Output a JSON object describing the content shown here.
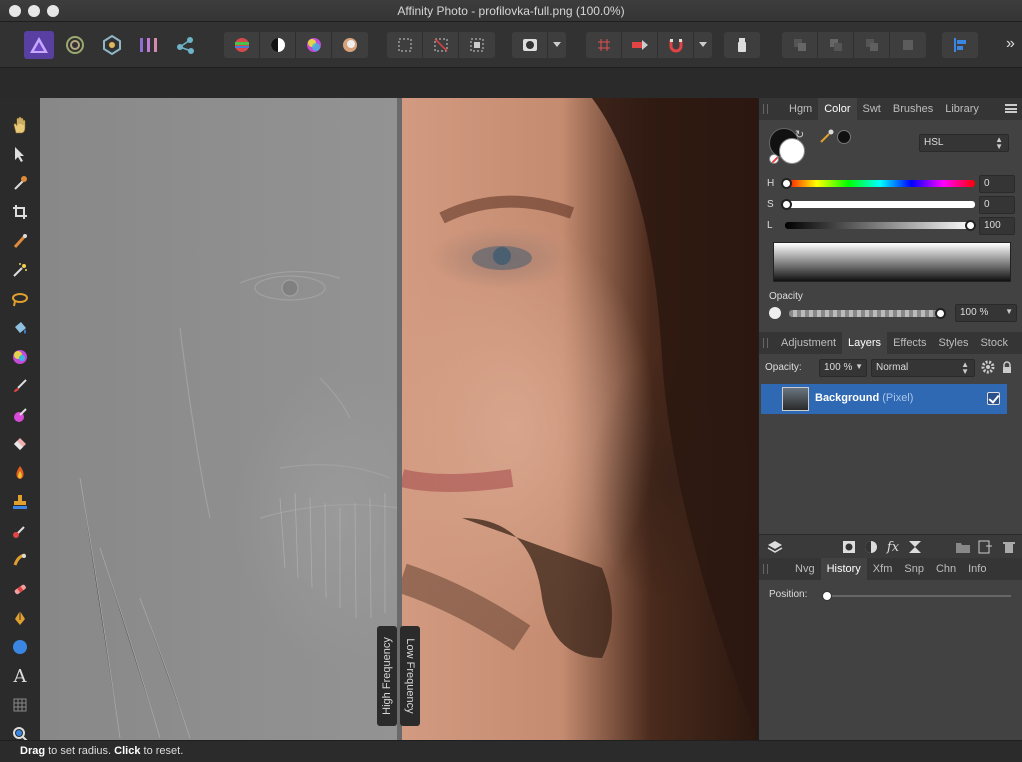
{
  "window": {
    "title": "Affinity Photo - profilovka-full.png (100.0%)"
  },
  "toolbar": {
    "personas": [
      "photo-persona-icon",
      "liquify-persona-icon",
      "develop-persona-icon",
      "tone-mapping-persona-icon",
      "export-persona-icon"
    ],
    "adjustments": [
      "auto-levels-icon",
      "auto-contrast-icon",
      "auto-colors-icon",
      "auto-white-balance-icon"
    ],
    "selection": [
      "marquee-icon",
      "deselect-icon",
      "invert-selection-icon"
    ],
    "more_label": "»"
  },
  "tools": [
    "hand-icon",
    "move-icon",
    "color-picker-icon",
    "crop-icon",
    "selection-brush-icon",
    "flood-select-icon",
    "freehand-select-icon",
    "flood-fill-icon",
    "gradient-icon",
    "paint-brush-icon",
    "color-replacement-icon",
    "erase-brush-icon",
    "dodge-icon",
    "clone-icon",
    "retouch-icon",
    "healing-icon",
    "patch-icon",
    "pen-icon",
    "shape-icon",
    "text-icon",
    "mesh-warp-icon",
    "zoom-icon"
  ],
  "canvas": {
    "left_label": "High Frequency",
    "right_label": "Low Frequency"
  },
  "status": {
    "drag": "Drag",
    "drag_text": " to set radius. ",
    "click": "Click",
    "click_text": " to reset."
  },
  "color_panel": {
    "tabs": [
      "Hgm",
      "Color",
      "Swt",
      "Brushes",
      "Library"
    ],
    "active_tab": "Color",
    "model": "HSL",
    "h_label": "H",
    "h_value": "0",
    "s_label": "S",
    "s_value": "0",
    "l_label": "L",
    "l_value": "100",
    "opacity_label": "Opacity",
    "opacity_value": "100 %"
  },
  "layers_panel": {
    "tabs": [
      "Adjustment",
      "Layers",
      "Effects",
      "Styles",
      "Stock"
    ],
    "active_tab": "Layers",
    "opacity_label": "Opacity:",
    "opacity_value": "100 %",
    "blend_mode": "Normal",
    "layers": [
      {
        "name": "Background",
        "type": "(Pixel)",
        "visible": true
      }
    ]
  },
  "history_panel": {
    "tabs": [
      "Nvg",
      "History",
      "Xfm",
      "Snp",
      "Chn",
      "Info"
    ],
    "active_tab": "History",
    "position_label": "Position:"
  },
  "colors": {
    "accent": "#2f68b3",
    "background": "#424242"
  }
}
